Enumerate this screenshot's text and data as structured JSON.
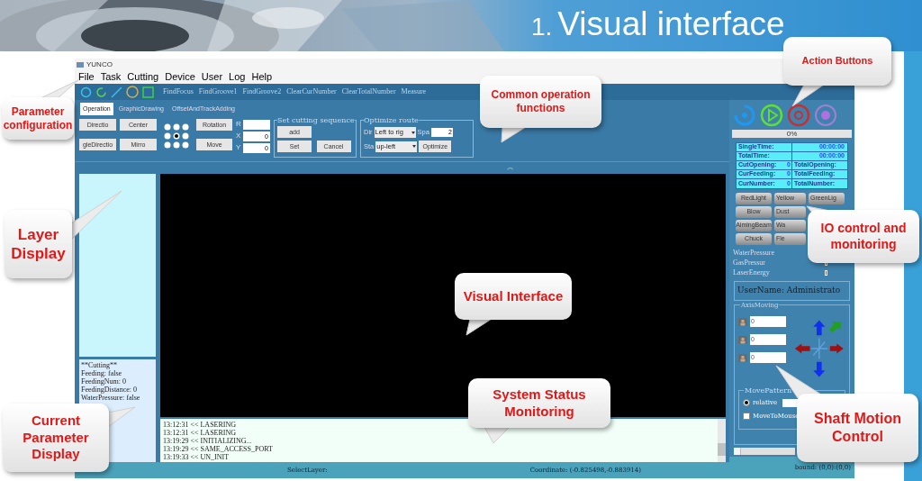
{
  "banner": {
    "number": "1.",
    "title": "Visual interface"
  },
  "window": {
    "title": "YUNCO"
  },
  "menu": [
    "File",
    "Task",
    "Cutting",
    "Device",
    "User",
    "Log",
    "Help"
  ],
  "toolbar": [
    "FindFocus",
    "FindGroove1",
    "FindGroove2",
    "ClearCurNumber",
    "ClearTotalNumber",
    "Measure"
  ],
  "tabs": [
    {
      "label": "Operation",
      "selected": true
    },
    {
      "label": "GraphicDrawing",
      "selected": false
    },
    {
      "label": "OffsetAndTrackAdding",
      "selected": false
    }
  ],
  "operation": {
    "buttons": [
      "Directio",
      "Center",
      "gleDirectio",
      "Mirro"
    ],
    "transform_buttons": [
      "Rotation",
      "Move"
    ],
    "fields": [
      {
        "label": "R"
      },
      {
        "label": "X",
        "value": "0"
      },
      {
        "label": "Y",
        "value": "0"
      }
    ],
    "sequence": {
      "title": "Set cutting sequence",
      "buttons": [
        "add",
        "Set",
        "Cancel"
      ]
    },
    "optimize": {
      "title": "Optimize route",
      "dir": {
        "label": "Dir",
        "value": "Left to rig"
      },
      "spacing": {
        "label": "Spa",
        "value": "2"
      },
      "start": {
        "label": "Sta",
        "value": "up-left"
      },
      "button": "Optimize"
    }
  },
  "collapse_toggle": "︽",
  "param_display": [
    "**Cutting**",
    "Feeding: false",
    "FeedingNum: 0",
    "FeedingDistance: 0",
    "WaterPressure: false"
  ],
  "log": [
    "13:12:31 << LASERING",
    "13:12:31 << LASERING",
    "13:19:29 << INITIALIZING...",
    "13:19:29 << SAME_ACCESS_PORT",
    "13:19:33 << UN_INIT"
  ],
  "status_bar": {
    "select_layer": "SelectLayer:",
    "coordinate": "Coordinate: (-0.825498,-0.883914)",
    "bound": "bound: (0,0):(0,0)"
  },
  "right_panel": {
    "progress": {
      "level": 0,
      "label": "0%"
    },
    "times": [
      {
        "label": "SingleTime:",
        "value": "00:00:00"
      },
      {
        "label": "TotalTime:",
        "value": "00:00:00"
      }
    ],
    "counters": [
      {
        "label": "CutOpening:",
        "value": "0",
        "total_label": "TotalOpening:"
      },
      {
        "label": "CurFeeding:",
        "value": "0",
        "total_label": "TotalFeeding:"
      },
      {
        "label": "CurNumber:",
        "value": "0",
        "total_label": "TotalNumber:"
      }
    ],
    "io_buttons": [
      [
        "RedLight",
        "Yellow",
        "GreenLig"
      ],
      [
        "Blow",
        "Dust"
      ],
      [
        "AimingBeam",
        "Wa"
      ],
      [
        "Chuck",
        "Fle"
      ]
    ],
    "sensors": [
      "WaterPressure",
      "GasPressur",
      "LaserEnergy"
    ],
    "user": "UserName: Administrato",
    "axis": {
      "title": "AxisMoving",
      "fields": [
        "0",
        "0",
        "0"
      ],
      "pattern": {
        "title": "MovePattern",
        "relative": {
          "label": "relative",
          "selected": true
        },
        "move_to_mouse": {
          "label": "MoveToMouse",
          "checked": false
        }
      }
    }
  },
  "callouts": [
    "Parameter configuration",
    "Action Buttons",
    "Common operation functions",
    "Layer Display",
    "IO control and monitoring",
    "Visual Interface",
    "Current Parameter Display",
    "System Status Monitoring",
    "Shaft Motion Control"
  ]
}
